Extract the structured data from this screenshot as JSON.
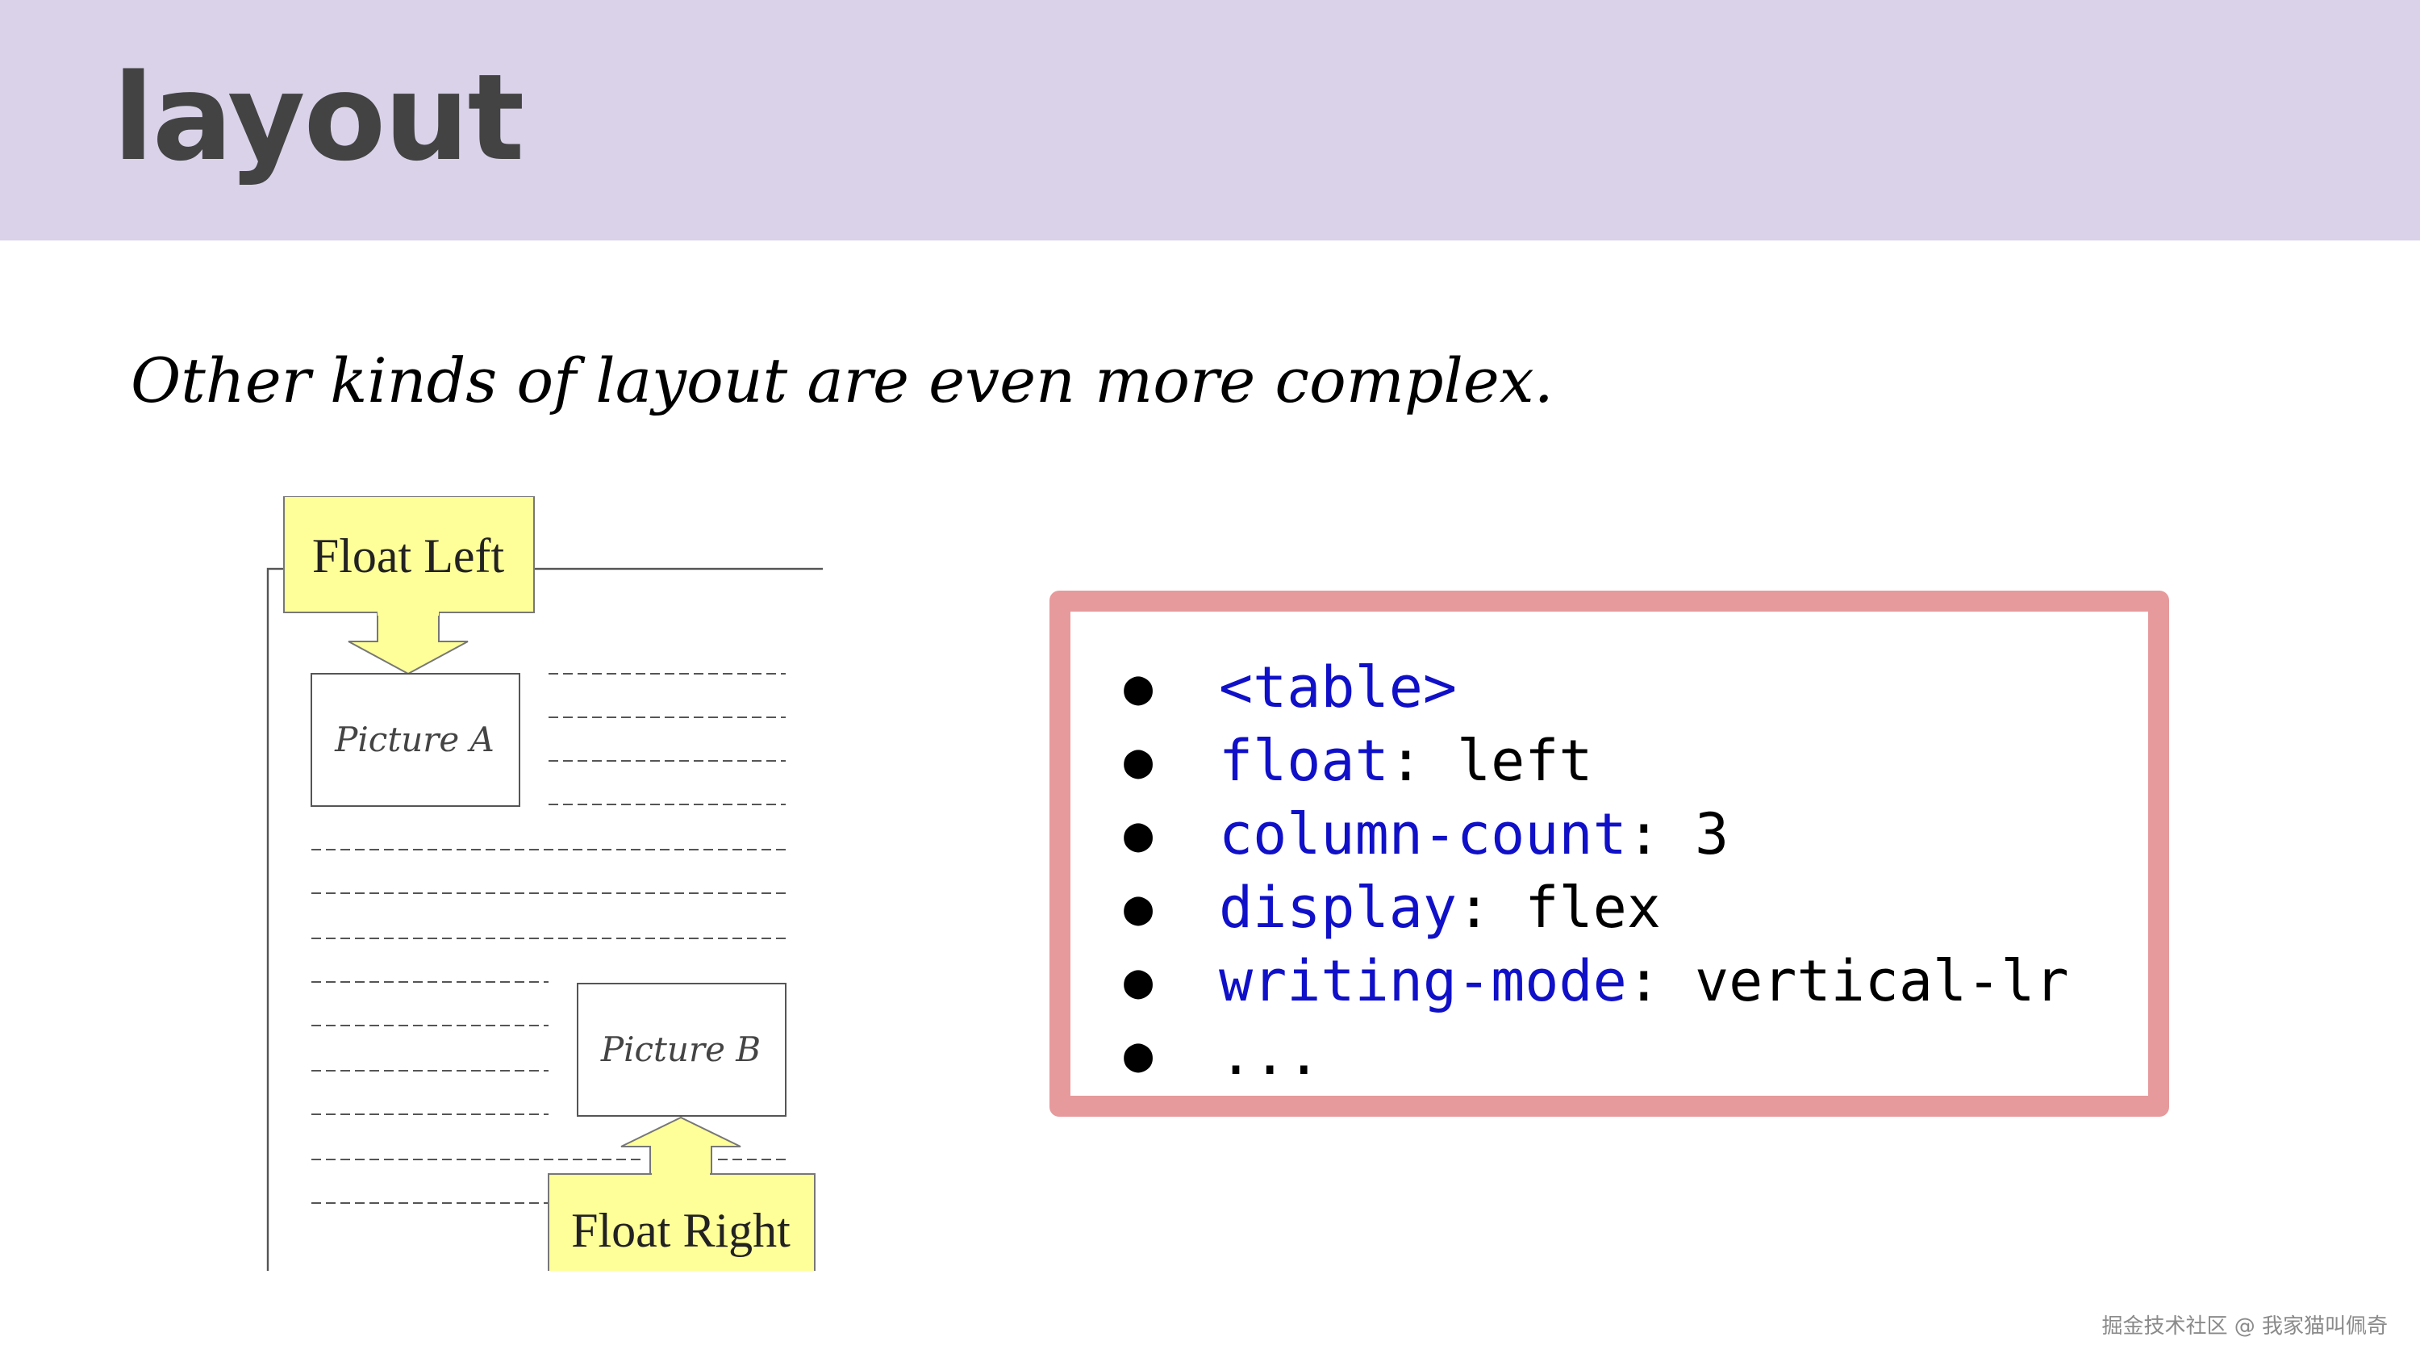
{
  "header": {
    "title": "layout",
    "bg_color": "#d9d2e9",
    "text_color": "#434343"
  },
  "subtitle": "Other kinds of layout are even more complex.",
  "figure": {
    "float_left_label": "Float Left",
    "float_right_label": "Float Right",
    "picture_a_label": "Picture A",
    "picture_b_label": "Picture B",
    "callout_color": "#ffff99"
  },
  "code_box": {
    "border_color": "#e69a9c",
    "keyword_color": "#1010c8",
    "items": [
      {
        "bullet": "●",
        "keyword": "<table>",
        "rest": ""
      },
      {
        "bullet": "●",
        "keyword": "float",
        "rest": ": left"
      },
      {
        "bullet": "●",
        "keyword": "column-count",
        "rest": ": 3"
      },
      {
        "bullet": "●",
        "keyword": "display",
        "rest": ": flex"
      },
      {
        "bullet": "●",
        "keyword": "writing-mode",
        "rest": ": vertical-lr"
      },
      {
        "bullet": "●",
        "keyword": "",
        "rest": "..."
      }
    ]
  },
  "watermark": "掘金技术社区 @ 我家猫叫佩奇"
}
